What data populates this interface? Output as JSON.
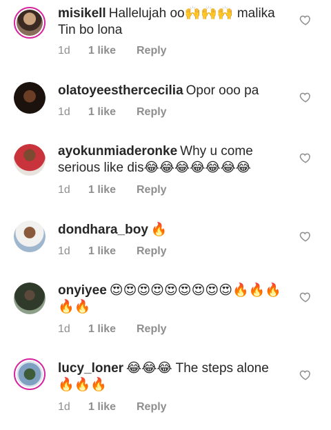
{
  "comments": [
    {
      "username": "misikell",
      "text": "Hallelujah oo🙌🙌🙌 malika Tin bo lona",
      "time": "1d",
      "likes": "1 like",
      "reply": "Reply",
      "avatar_icon": "avatar-photo",
      "ring": true
    },
    {
      "username": "olatoyeesthercecilia",
      "text": "Opor ooo pa",
      "time": "1d",
      "likes": "1 like",
      "reply": "Reply",
      "avatar_icon": "avatar-photo",
      "ring": false
    },
    {
      "username": "ayokunmiaderonke",
      "text": "Why u come serious like dis😂😂😂😂😂😂😂",
      "time": "1d",
      "likes": "1 like",
      "reply": "Reply",
      "avatar_icon": "avatar-photo",
      "ring": false
    },
    {
      "username": "dondhara_boy",
      "text": "🔥",
      "time": "1d",
      "likes": "1 like",
      "reply": "Reply",
      "avatar_icon": "avatar-photo",
      "ring": false
    },
    {
      "username": "onyiyee",
      "text": "😍😍😍😍😍😍😍😍😍🔥🔥🔥🔥🔥",
      "time": "1d",
      "likes": "1 like",
      "reply": "Reply",
      "avatar_icon": "avatar-photo",
      "ring": false
    },
    {
      "username": "lucy_loner",
      "text": "😂😂😂 The steps alone 🔥🔥🔥",
      "time": "1d",
      "likes": "1 like",
      "reply": "Reply",
      "avatar_icon": "avatar-photo",
      "ring": true
    }
  ],
  "icons": {
    "like": "heart-outline-icon"
  },
  "colors": {
    "text": "#262626",
    "muted": "#8e8e8e",
    "story_ring": "#d6249f"
  }
}
